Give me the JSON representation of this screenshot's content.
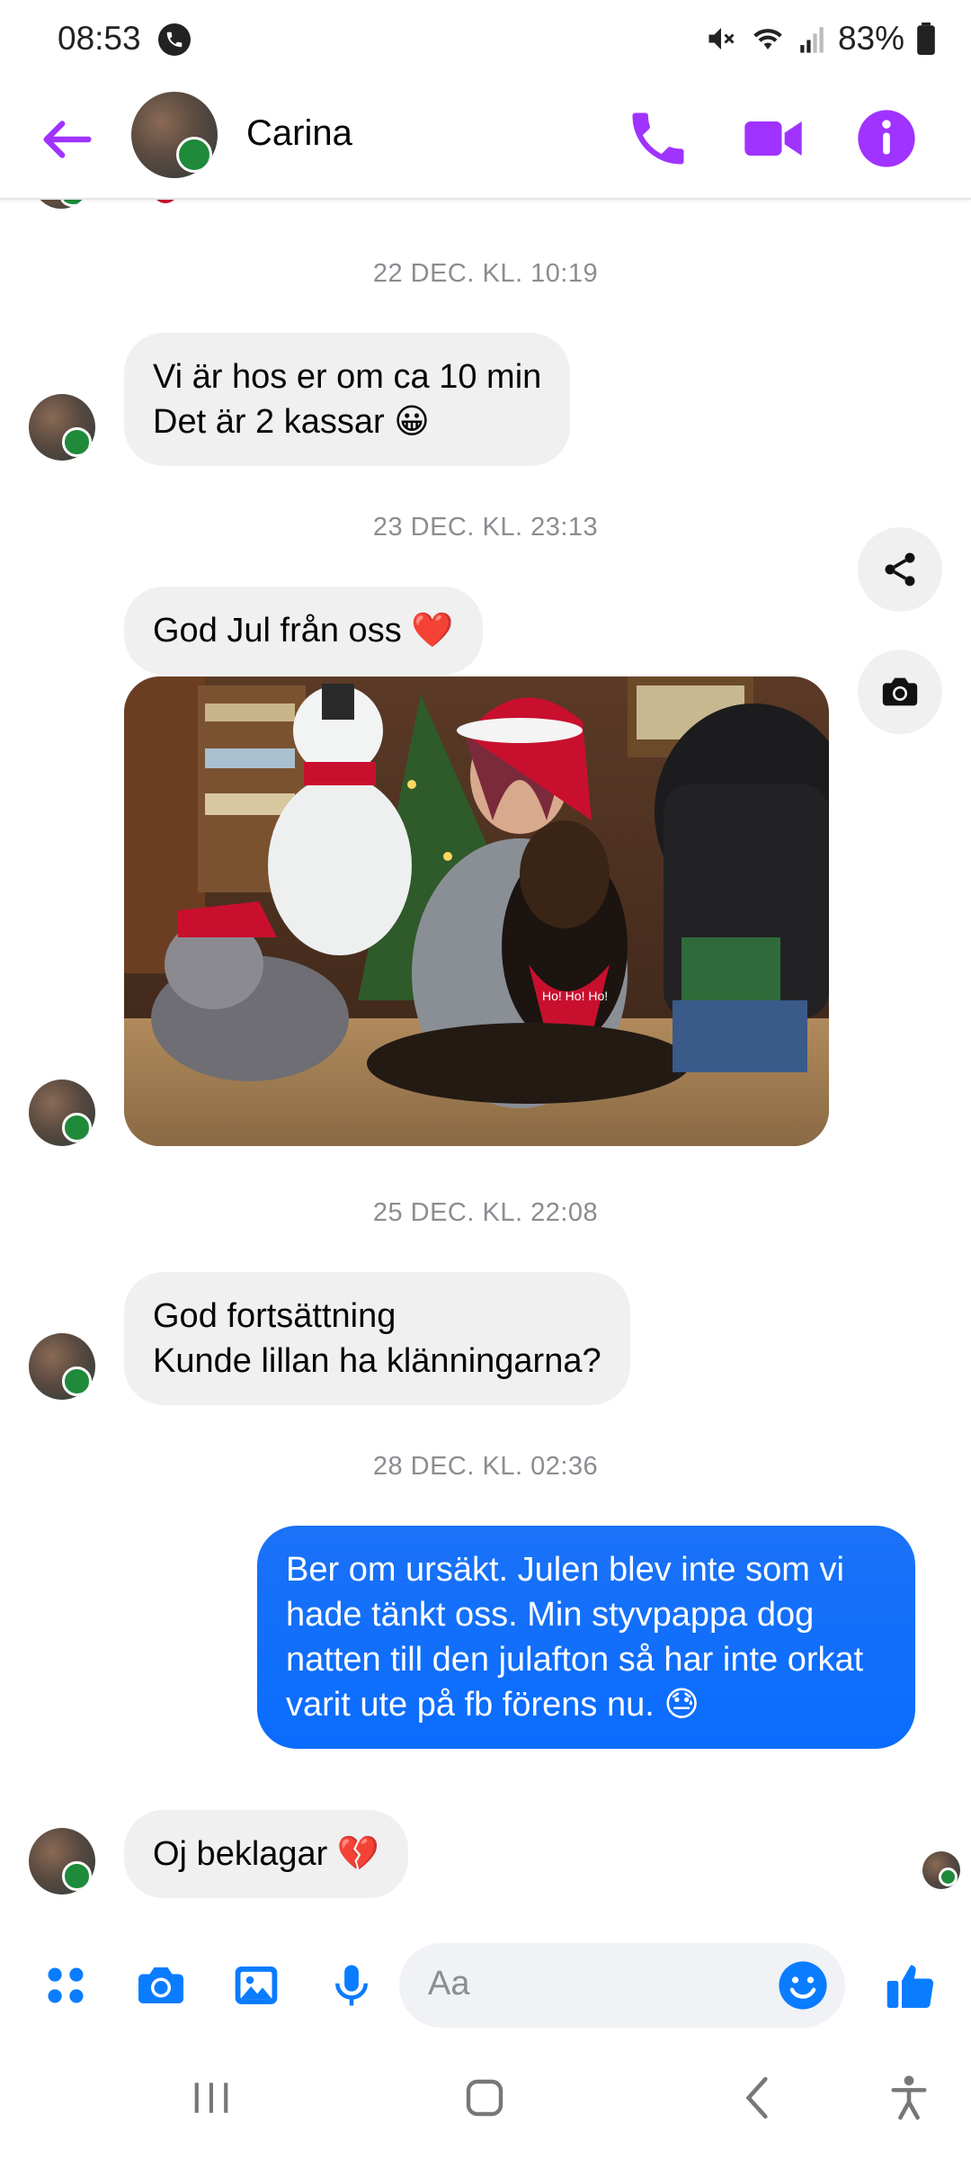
{
  "status": {
    "time": "08:53",
    "battery": "83%"
  },
  "header": {
    "contact_name": "Carina"
  },
  "messages": {
    "ts1": "22 DEC. KL. 10:19",
    "m1_line1": "Vi är hos er om ca 10 min",
    "m1_line2": "Det är 2 kassar 😀",
    "ts2": "23 DEC. KL. 23:13",
    "m2": "God Jul från oss ❤️",
    "ts3": "25 DEC. KL. 22:08",
    "m3_line1": "God fortsättning",
    "m3_line2": "Kunde lillan ha klänningarna?",
    "ts4": "28 DEC. KL. 02:36",
    "m4": "Ber om ursäkt.  Julen blev inte som vi hade tänkt oss. Min styvpappa dog natten till den julafton så har inte orkat varit ute på fb förens nu. 😓",
    "m5": "Oj beklagar 💔"
  },
  "photo": {
    "santa_hat_text": "Ho! Ho! Ho!"
  },
  "composer": {
    "placeholder": "Aa"
  },
  "colors": {
    "accent_purple": "#a033ff",
    "messenger_blue": "#0a7cff",
    "bubble_gray": "#f0f0f0"
  },
  "icons": {
    "back": "arrow-left-icon",
    "call": "phone-icon",
    "video": "video-camera-icon",
    "info": "info-icon",
    "share": "share-icon",
    "camera": "camera-icon",
    "apps": "apps-grid-icon",
    "gallery": "image-icon",
    "mic": "microphone-icon",
    "emoji": "emoji-icon",
    "like": "thumbs-up-icon"
  }
}
